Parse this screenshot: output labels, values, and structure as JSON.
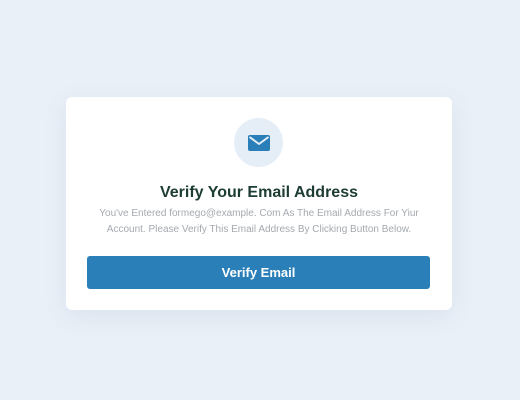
{
  "card": {
    "icon": "envelope-icon",
    "title": "Verify Your Email Address",
    "message": "You've Entered formego@example. Com As The Email Address For Yiur Account. Please Verify This Email Address By Clicking Button Below.",
    "button_label": "Verify Email"
  },
  "colors": {
    "background": "#e9f0f8",
    "card": "#ffffff",
    "icon_circle": "#e5eef7",
    "icon": "#2a7fb8",
    "title": "#1d3c34",
    "message": "#a5aaaf",
    "button": "#2a7fb8",
    "button_text": "#ffffff"
  }
}
